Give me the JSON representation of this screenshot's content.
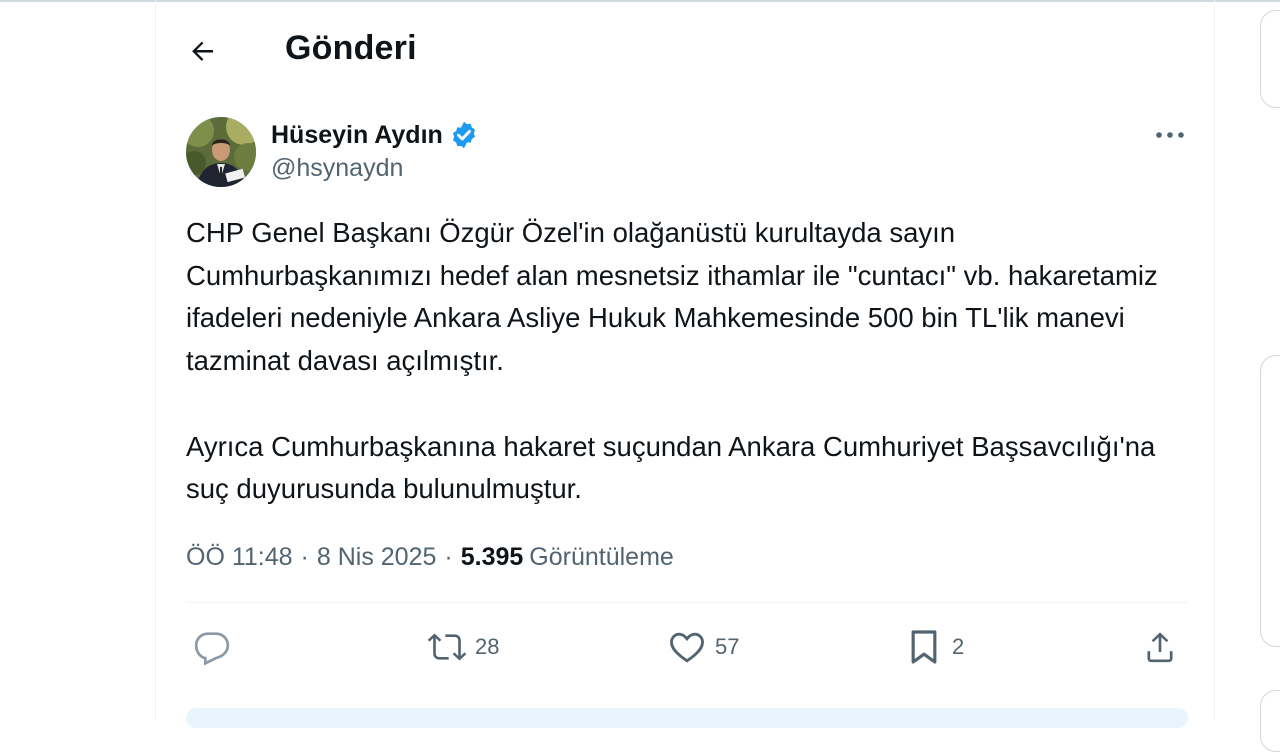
{
  "header": {
    "title": "Gönderi"
  },
  "tweet": {
    "author_name": "Hüseyin Aydın",
    "handle": "@hsynaydn",
    "verified": true,
    "paragraphs": [
      "CHP Genel Başkanı Özgür Özel'in olağanüstü kurultayda sayın Cumhurbaşkanımızı hedef alan mesnetsiz ithamlar ile \"cuntacı\" vb. hakaretamiz ifadeleri nedeniyle Ankara Asliye Hukuk Mahkemesinde 500 bin TL'lik manevi tazminat davası açılmıştır.",
      "Ayrıca Cumhurbaşkanına hakaret suçundan Ankara Cumhuriyet Başsavcılığı'na suç duyurusunda bulunulmuştur."
    ],
    "time": "ÖÖ 11:48",
    "date": "8 Nis 2025",
    "separator": "·",
    "views_count": "5.395",
    "views_label": "Görüntüleme"
  },
  "actions": {
    "retweets": "28",
    "likes": "57",
    "bookmarks": "2"
  },
  "icons": {
    "back": "arrow-left-icon",
    "verified": "verified-badge-icon",
    "more": "more-horizontal-icon",
    "reply": "reply-icon",
    "retweet": "retweet-icon",
    "like": "heart-icon",
    "bookmark": "bookmark-icon",
    "share": "share-icon"
  },
  "colors": {
    "verified": "#1d9bf0",
    "text_primary": "#0f1419",
    "text_secondary": "#536471"
  }
}
